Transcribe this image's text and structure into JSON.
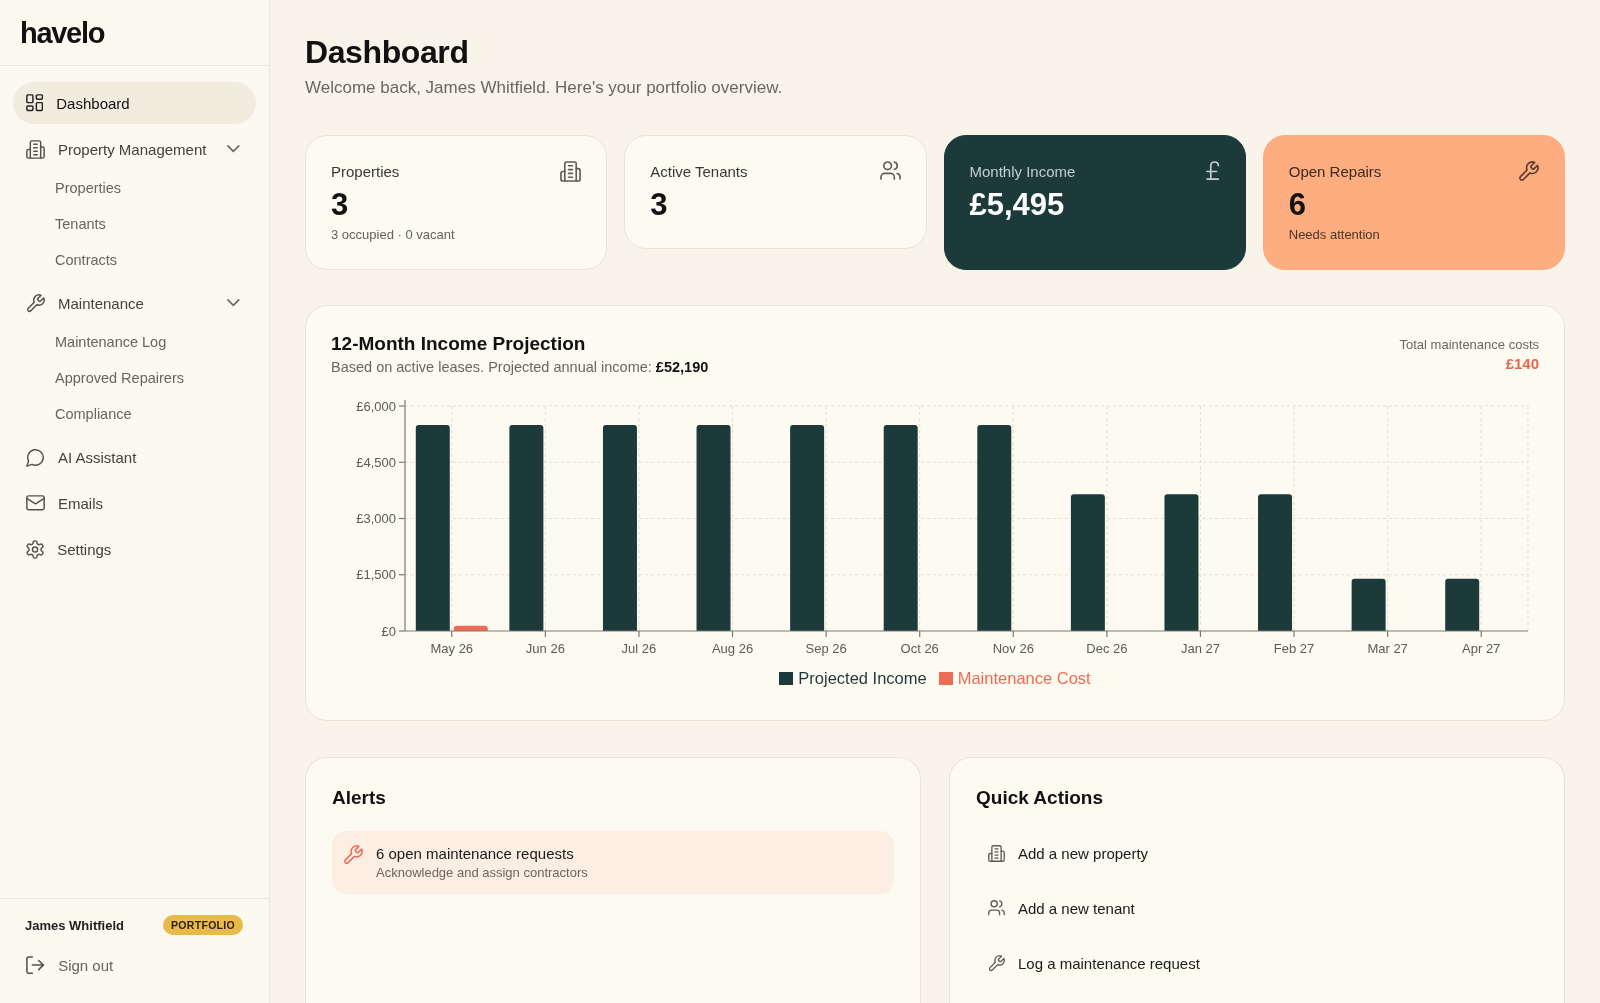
{
  "sidebar": {
    "logo": "havelo",
    "nav": [
      {
        "label": "Dashboard",
        "selected": true
      },
      {
        "label": "Property Management",
        "selected": false,
        "expanded": true,
        "children": [
          {
            "label": "Properties",
            "selected": false
          },
          {
            "label": "Tenants",
            "selected": false
          },
          {
            "label": "Contracts",
            "selected": false
          }
        ]
      },
      {
        "label": "Maintenance",
        "selected": false,
        "expanded": true,
        "children": [
          {
            "label": "Maintenance Log",
            "selected": false
          },
          {
            "label": "Approved Repairers",
            "selected": false
          },
          {
            "label": "Compliance",
            "selected": false
          }
        ]
      },
      {
        "label": "AI Assistant",
        "selected": false
      },
      {
        "label": "Emails",
        "selected": false
      },
      {
        "label": "Settings",
        "selected": false
      }
    ],
    "user": {
      "name": "James Whitfield",
      "badge": "PORTFOLIO"
    },
    "sign_out": "Sign out"
  },
  "header": {
    "title": "Dashboard",
    "subtitle": "Welcome back, James Whitfield. Here's your portfolio overview."
  },
  "stats": [
    {
      "kind": "plain",
      "label": "Properties",
      "value": "3",
      "note": "3 occupied · 0 vacant"
    },
    {
      "kind": "plain",
      "label": "Active Tenants",
      "value": "3"
    },
    {
      "kind": "dark",
      "label": "Monthly Income",
      "value": "£5,495"
    },
    {
      "kind": "accent",
      "label": "Open Repairs",
      "value": "6",
      "note": "Needs attention"
    }
  ],
  "income_projection": {
    "title": "12-Month Income Projection",
    "subtitle": "Based on active leases. Projected annual income: **£52,190**",
    "total_label": "Total maintenance costs",
    "total_value": "£140",
    "chart_data": {
      "type": "bar",
      "categories": [
        "May 26",
        "Jun 26",
        "Jul 26",
        "Aug 26",
        "Sep 26",
        "Oct 26",
        "Nov 26",
        "Dec 26",
        "Jan 27",
        "Feb 27",
        "Mar 27",
        "Apr 27"
      ],
      "series": [
        {
          "name": "Projected Income",
          "color": "#1c3a3a",
          "values": [
            5495,
            5495,
            5495,
            5495,
            5495,
            5495,
            5495,
            3645,
            3645,
            3645,
            1395,
            1395
          ]
        },
        {
          "name": "Maintenance Cost",
          "color": "#ee6b55",
          "values": [
            140,
            0,
            0,
            0,
            0,
            0,
            0,
            0,
            0,
            0,
            0,
            0
          ]
        }
      ],
      "ylim": [
        0,
        6000
      ],
      "yticks": [
        {
          "value": 0,
          "label": "£0"
        },
        {
          "value": 1500,
          "label": "£1,500"
        },
        {
          "value": 3000,
          "label": "£3,000"
        },
        {
          "value": 4500,
          "label": "£4,500"
        },
        {
          "value": 6000,
          "label": "£6,000"
        }
      ],
      "grid": true,
      "legend": true
    }
  },
  "alerts": {
    "title": "Alerts",
    "items": [
      {
        "title": "6 open maintenance requests",
        "detail": "Acknowledge and assign contractors"
      }
    ]
  },
  "quick_actions": {
    "title": "Quick Actions",
    "items": [
      "Add a new property",
      "Add a new tenant",
      "Log a maintenance request"
    ]
  }
}
